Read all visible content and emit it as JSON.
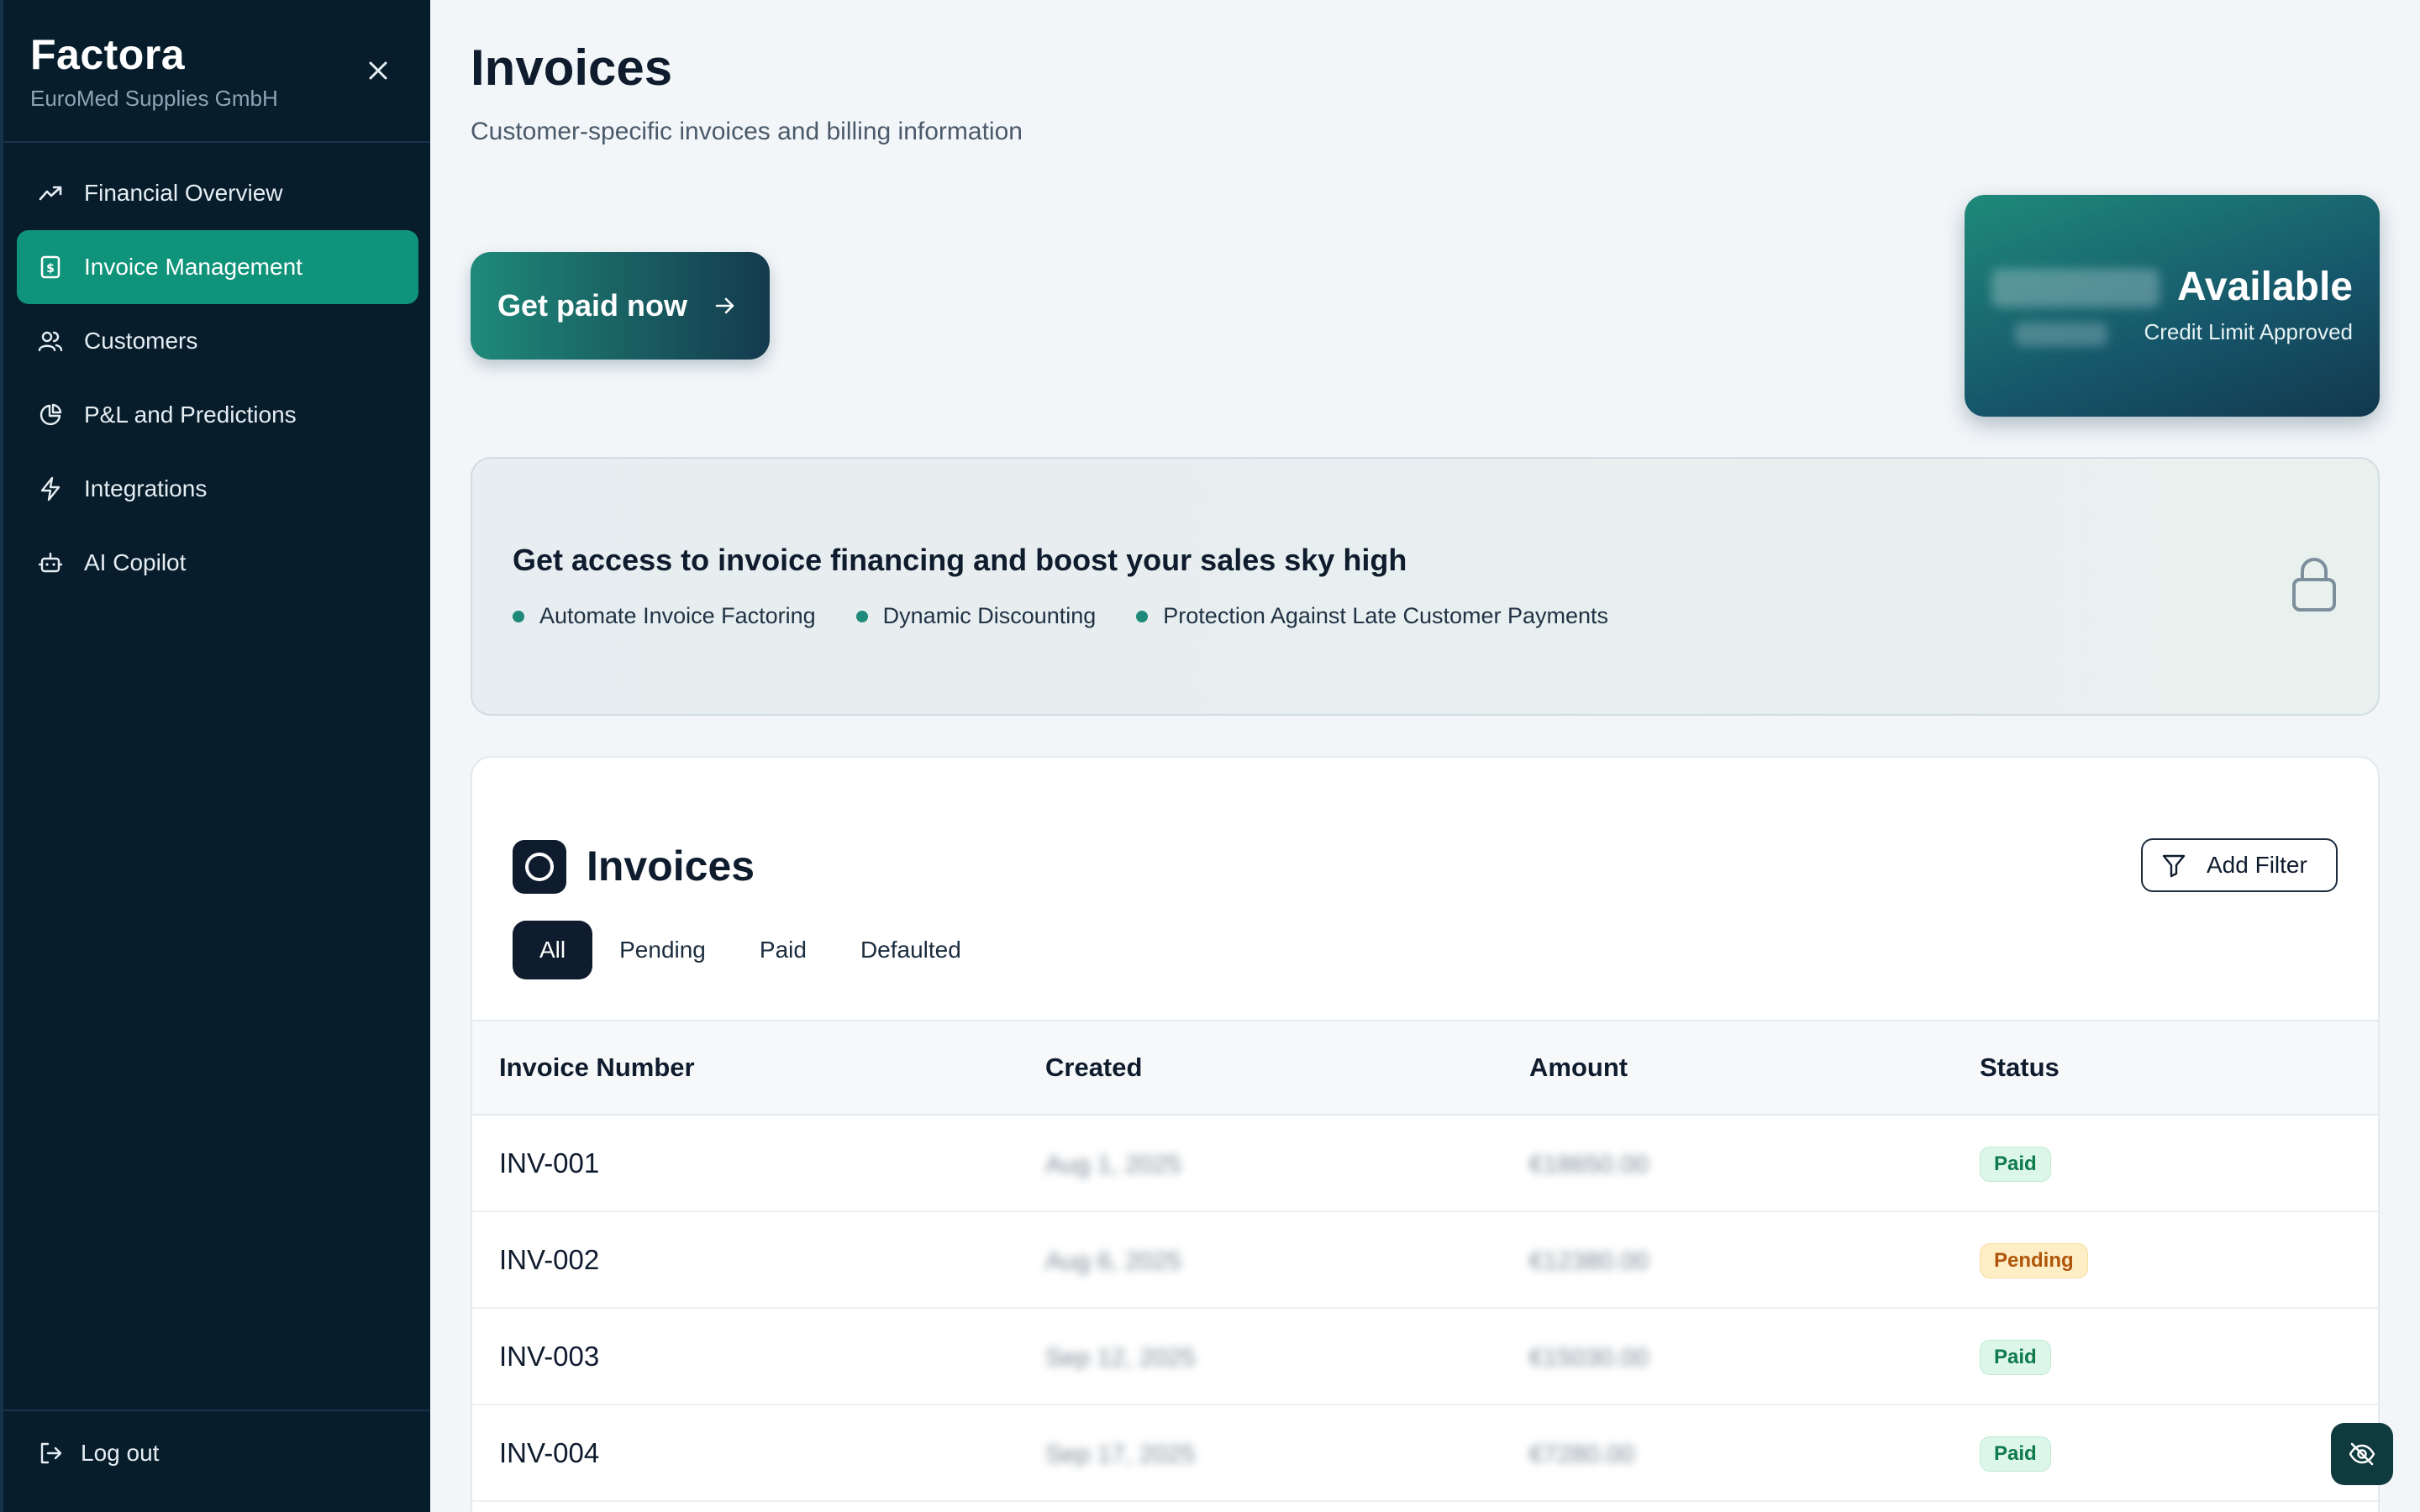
{
  "sidebar": {
    "brand_name": "Factora",
    "brand_sub": "EuroMed Supplies GmbH",
    "items": [
      {
        "label": "Financial Overview",
        "icon": "trending-up-icon"
      },
      {
        "label": "Invoice Management",
        "icon": "invoice-icon",
        "active": true
      },
      {
        "label": "Customers",
        "icon": "users-icon"
      },
      {
        "label": "P&L and Predictions",
        "icon": "pie-chart-icon"
      },
      {
        "label": "Integrations",
        "icon": "lightning-icon"
      },
      {
        "label": "AI Copilot",
        "icon": "robot-icon"
      }
    ],
    "logout_label": "Log out"
  },
  "header": {
    "title": "Invoices",
    "subtitle": "Customer-specific invoices and billing information"
  },
  "get_paid": {
    "label": "Get paid now"
  },
  "credit_card": {
    "amount": "€85,834",
    "available_label": "Available",
    "limit_value": "€100,000",
    "limit_label": "Credit Limit Approved"
  },
  "promo": {
    "title": "Get access to invoice financing and boost your sales sky high",
    "features": [
      "Automate Invoice Factoring",
      "Dynamic Discounting",
      "Protection Against Late Customer Payments"
    ]
  },
  "invoices": {
    "title": "Invoices",
    "add_filter_label": "Add Filter",
    "tabs": [
      "All",
      "Pending",
      "Paid",
      "Defaulted"
    ],
    "active_tab": "All",
    "columns": [
      "Invoice Number",
      "Created",
      "Amount",
      "Status"
    ],
    "rows": [
      {
        "number": "INV-001",
        "created": "Aug 1, 2025",
        "amount": "€18650.00",
        "status": "Paid"
      },
      {
        "number": "INV-002",
        "created": "Aug 6, 2025",
        "amount": "€12380.00",
        "status": "Pending"
      },
      {
        "number": "INV-003",
        "created": "Sep 12, 2025",
        "amount": "€15030.00",
        "status": "Paid"
      },
      {
        "number": "INV-004",
        "created": "Sep 17, 2025",
        "amount": "€7280.00",
        "status": "Paid"
      }
    ]
  },
  "colors": {
    "sidebar_bg": "#071d2b",
    "accent": "#0f937a",
    "paid_badge": "#ddf6ea",
    "pending_badge": "#fdeec6"
  }
}
